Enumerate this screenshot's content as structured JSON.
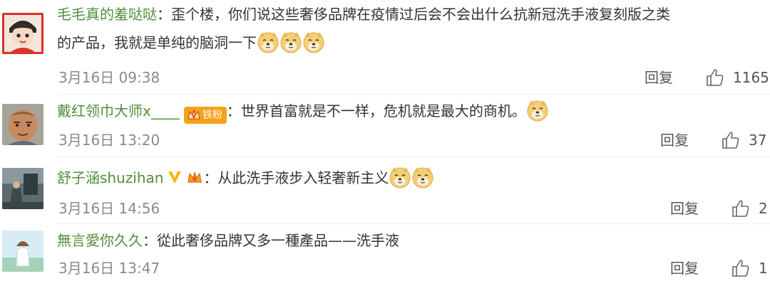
{
  "comments": [
    {
      "username": "毛毛真的羞哒哒",
      "text_line1": "：歪个楼，你们说这些奢侈品牌在疫情过后会不会出什么抗新冠洗手液复刻版之类",
      "text_line2": "的产品，我就是单纯的脑洞一下",
      "emojis": [
        "doge-emoji",
        "doge-emoji",
        "doge-emoji"
      ],
      "time": "3月16日 09:38",
      "reply_label": "回复",
      "likes": "1165"
    },
    {
      "username": "戴红领巾大师x____",
      "badge": "铁粉",
      "text": "：世界首富就是不一样，危机就是最大的商机。",
      "emojis": [
        "doge-emoji"
      ],
      "time": "3月16日 13:20",
      "reply_label": "回复",
      "likes": "37"
    },
    {
      "username": "舒子涵shuzihan",
      "text": "：从此洗手液步入轻奢新主义",
      "emojis": [
        "doge-emoji",
        "doge-emoji"
      ],
      "time": "3月16日 14:56",
      "reply_label": "回复",
      "likes": "2"
    },
    {
      "username": "無言愛你久久",
      "text": "：從此奢侈品牌又多一種產品——洗手液",
      "time": "3月16日 13:47",
      "reply_label": "回复",
      "likes": "1"
    }
  ],
  "colors": {
    "username": "#4f8e3b",
    "time": "#8a8a8a",
    "badge": "#f7a11a",
    "verified": "#f6b40e"
  }
}
